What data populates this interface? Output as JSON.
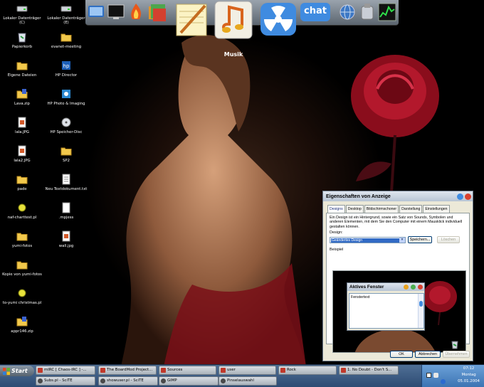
{
  "desktop": {
    "col1": [
      {
        "label": "Lokaler Datenträger (C)",
        "icon": "drive-icon"
      },
      {
        "label": "Papierkorb",
        "icon": "recycle-bin-icon"
      },
      {
        "label": "Eigene Dateien",
        "icon": "folder-icon"
      },
      {
        "label": "Lava.zip",
        "icon": "zip-icon"
      },
      {
        "label": "lala.JPG",
        "icon": "image-file-icon"
      },
      {
        "label": "lala2.JPG",
        "icon": "image-file-icon"
      },
      {
        "label": "pade",
        "icon": "folder-icon"
      },
      {
        "label": "naf-charttest.pl",
        "icon": "perl-icon"
      },
      {
        "label": "yumi-fotos",
        "icon": "folder-icon"
      },
      {
        "label": "Kopie von yumi-fotos",
        "icon": "folder-icon"
      },
      {
        "label": "to-yumi christmas.pl",
        "icon": "perl-icon"
      },
      {
        "label": "appr146.zip",
        "icon": "zip-icon"
      }
    ],
    "col2": [
      {
        "label": "Lokaler Datenträger (E)",
        "icon": "drive-icon"
      },
      {
        "label": "evanet-meeting",
        "icon": "folder-icon"
      },
      {
        "label": "HP Director",
        "icon": "hp-director-icon"
      },
      {
        "label": "HP Photo & Imaging",
        "icon": "hp-photo-icon"
      },
      {
        "label": "HP Speicher-Disc",
        "icon": "hp-disc-icon"
      },
      {
        "label": "SP2",
        "icon": "folder-icon"
      },
      {
        "label": "Neu Textdokument.txt",
        "icon": "text-file-icon"
      },
      {
        "label": ".mpjess",
        "icon": "file-icon"
      },
      {
        "label": "wall.jpg",
        "icon": "image-file-icon"
      }
    ]
  },
  "launcher": {
    "active_label": "Musik",
    "items": [
      "desktop-icon",
      "monitor-icon",
      "fire-icon",
      "folder-stack-icon",
      "notepad-icon",
      "music-icon",
      "radiation-icon",
      "chat-icon",
      "globe-icon",
      "tools-icon",
      "system-monitor-icon"
    ],
    "chat_text": "chat"
  },
  "dialog": {
    "title": "Eigenschaften von Anzeige",
    "tabs": [
      "Designs",
      "Desktop",
      "Bildschirmschoner",
      "Darstellung",
      "Einstellungen"
    ],
    "description": "Ein Design ist ein Hintergrund, sowie ein Satz von Sounds, Symbolen und anderen Elementen, mit dem Sie den Computer mit einem Mausklick individuell gestalten können.",
    "design_label": "Design:",
    "design_value": "Geändertes Design",
    "save_label": "Speichern...",
    "delete_label": "Löschen",
    "preview_label": "Beispiel",
    "preview_window_title": "Aktives Fenster",
    "preview_window_text": "Fenstertext",
    "ok_label": "OK",
    "cancel_label": "Abbrechen",
    "apply_label": "Übernehmen"
  },
  "taskbar": {
    "start_label": "Start",
    "row1": [
      {
        "label": "mIRC [ Chaos-IRC ] -...",
        "icon": "mirc-icon"
      },
      {
        "label": "The BoardMod Project...",
        "icon": "browser-icon"
      },
      {
        "label": "Sources",
        "icon": "folder-icon"
      },
      {
        "label": "user",
        "icon": "folder-icon"
      },
      {
        "label": "Rock",
        "icon": "folder-icon"
      },
      {
        "label": "1. No Doubt - Don't S...",
        "icon": "media-player-icon"
      }
    ],
    "row2": [
      {
        "label": "Subs.pl - SciTE",
        "icon": "scite-icon"
      },
      {
        "label": "showuser.pl - SciTE",
        "icon": "scite-icon"
      },
      {
        "label": "GIMP",
        "icon": "gimp-icon"
      },
      {
        "label": "Pinselauswahl",
        "icon": "gimp-icon"
      }
    ],
    "clock_time": "07:12",
    "clock_day": "Montag",
    "clock_date": "05.01.2004"
  }
}
